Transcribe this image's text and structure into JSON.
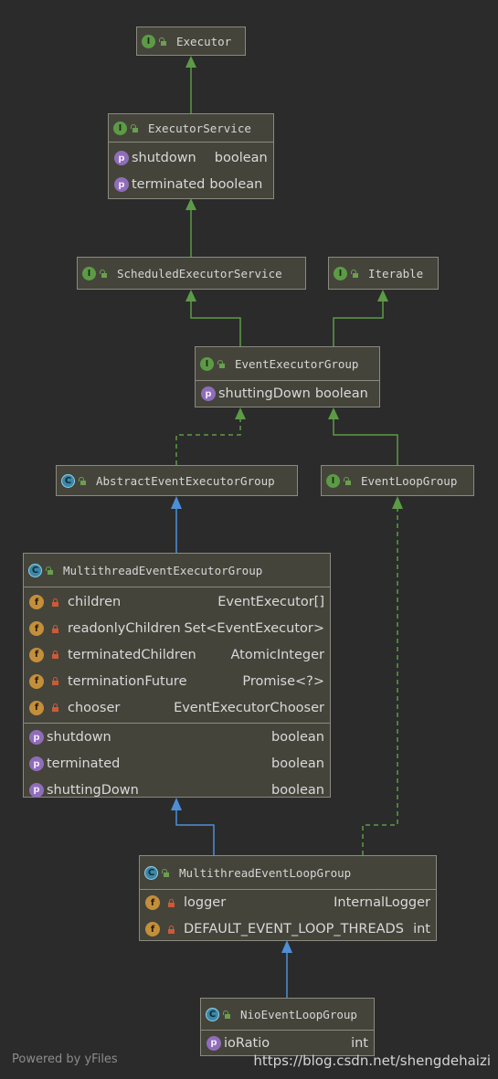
{
  "nodes": {
    "executor": {
      "badge": "I",
      "title": "Executor"
    },
    "executor_service": {
      "badge": "I",
      "title": "ExecutorService",
      "props": [
        {
          "badge": "p",
          "name": "shutdown",
          "type": "boolean"
        },
        {
          "badge": "p",
          "name": "terminated",
          "type": "boolean"
        }
      ]
    },
    "scheduled_executor_service": {
      "badge": "I",
      "title": "ScheduledExecutorService"
    },
    "iterable": {
      "badge": "I",
      "title": "Iterable"
    },
    "event_executor_group": {
      "badge": "I",
      "title": "EventExecutorGroup",
      "props": [
        {
          "badge": "p",
          "name": "shuttingDown",
          "type": "boolean"
        }
      ]
    },
    "abstract_event_executor_group": {
      "badge": "C",
      "title": "AbstractEventExecutorGroup"
    },
    "event_loop_group": {
      "badge": "I",
      "title": "EventLoopGroup"
    },
    "multithread_event_executor_group": {
      "badge": "C",
      "title": "MultithreadEventExecutorGroup",
      "fields": [
        {
          "badge": "f",
          "name": "children",
          "type": "EventExecutor[]"
        },
        {
          "badge": "f",
          "name": "readonlyChildren",
          "type": "Set<EventExecutor>"
        },
        {
          "badge": "f",
          "name": "terminatedChildren",
          "type": "AtomicInteger"
        },
        {
          "badge": "f",
          "name": "terminationFuture",
          "type": "Promise<?>"
        },
        {
          "badge": "f",
          "name": "chooser",
          "type": "EventExecutorChooser"
        }
      ],
      "props": [
        {
          "badge": "p",
          "name": "shutdown",
          "type": "boolean"
        },
        {
          "badge": "p",
          "name": "terminated",
          "type": "boolean"
        },
        {
          "badge": "p",
          "name": "shuttingDown",
          "type": "boolean"
        }
      ]
    },
    "multithread_event_loop_group": {
      "badge": "C",
      "title": "MultithreadEventLoopGroup",
      "fields": [
        {
          "badge": "f",
          "name": "logger",
          "type": "InternalLogger"
        },
        {
          "badge": "f",
          "name": "DEFAULT_EVENT_LOOP_THREADS",
          "type": "int"
        }
      ]
    },
    "nio_event_loop_group": {
      "badge": "C",
      "title": "NioEventLoopGroup",
      "props": [
        {
          "badge": "p",
          "name": "ioRatio",
          "type": "int"
        }
      ]
    }
  },
  "footer": {
    "left": "Powered by yFiles",
    "right": "https://blog.csdn.net/shengdehaizi"
  },
  "colors": {
    "background": "#2b2b2b",
    "node": "#45443b",
    "interface_edge": "#5c9b46",
    "class_edge": "#4d8fd6",
    "border": "#8a8a80"
  }
}
